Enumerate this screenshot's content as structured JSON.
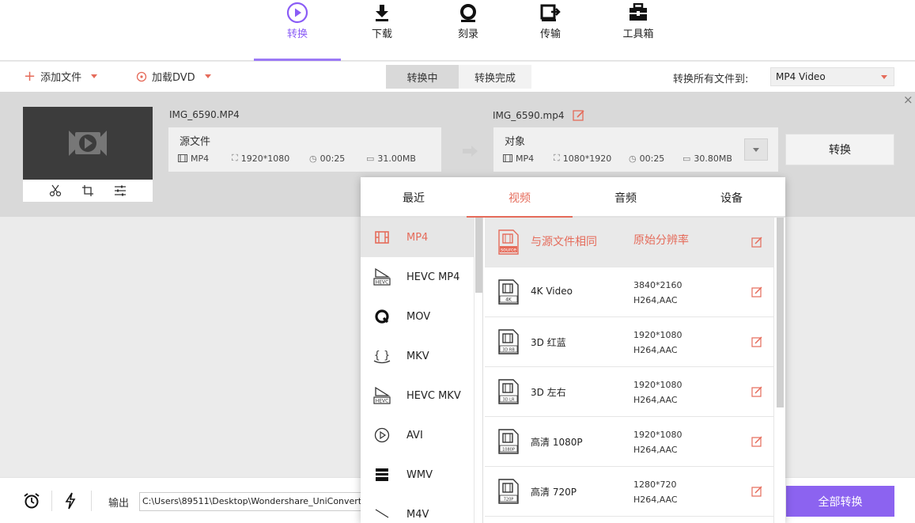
{
  "nav": {
    "items": [
      {
        "label": "转换",
        "icon": "convert-play-icon",
        "active": true
      },
      {
        "label": "下载",
        "icon": "download-icon",
        "active": false
      },
      {
        "label": "刻录",
        "icon": "burn-disc-icon",
        "active": false
      },
      {
        "label": "传输",
        "icon": "transfer-icon",
        "active": false
      },
      {
        "label": "工具箱",
        "icon": "toolbox-icon",
        "active": false
      }
    ]
  },
  "toolbar": {
    "add_files": "添加文件",
    "load_dvd": "加载DVD",
    "tab_converting": "转换中",
    "tab_converted": "转换完成",
    "convert_all_to_label": "转换所有文件到:",
    "convert_all_to_value": "MP4 Video"
  },
  "file": {
    "source_name": "IMG_6590.MP4",
    "target_name": "IMG_6590.mp4",
    "source": {
      "title": "源文件",
      "format": "MP4",
      "resolution": "1920*1080",
      "duration": "00:25",
      "size": "31.00MB"
    },
    "target": {
      "title": "对象",
      "format": "MP4",
      "resolution": "1080*1920",
      "duration": "00:25",
      "size": "30.80MB"
    },
    "convert_button": "转换"
  },
  "bottom": {
    "output_label": "输出",
    "output_path": "C:\\Users\\89511\\Desktop\\Wondershare_UniConvert",
    "convert_all_button": "全部转换"
  },
  "popup": {
    "tabs": [
      "最近",
      "视频",
      "音频",
      "设备"
    ],
    "active_tab": "视频",
    "formats": [
      {
        "label": "MP4",
        "icon": "film-icon",
        "active": true
      },
      {
        "label": "HEVC MP4",
        "icon": "hevc-icon",
        "active": false
      },
      {
        "label": "MOV",
        "icon": "quicktime-icon",
        "active": false
      },
      {
        "label": "MKV",
        "icon": "mkv-icon",
        "active": false
      },
      {
        "label": "HEVC MKV",
        "icon": "hevc-icon",
        "active": false
      },
      {
        "label": "AVI",
        "icon": "play-circle-icon",
        "active": false
      },
      {
        "label": "WMV",
        "icon": "clapper-icon",
        "active": false
      },
      {
        "label": "M4V",
        "icon": "m4v-icon",
        "active": false
      }
    ],
    "presets": [
      {
        "name": "与源文件相同",
        "res1": "原始分辨率",
        "res2": "",
        "badge": "source",
        "active": true
      },
      {
        "name": "4K Video",
        "res1": "3840*2160",
        "res2": "H264,AAC",
        "badge": "4K",
        "active": false
      },
      {
        "name": "3D 红蓝",
        "res1": "1920*1080",
        "res2": "H264,AAC",
        "badge": "3D RB",
        "active": false
      },
      {
        "name": "3D 左右",
        "res1": "1920*1080",
        "res2": "H264,AAC",
        "badge": "3D LR",
        "active": false
      },
      {
        "name": "高清 1080P",
        "res1": "1920*1080",
        "res2": "H264,AAC",
        "badge": "1080P",
        "active": false
      },
      {
        "name": "高清 720P",
        "res1": "1280*720",
        "res2": "H264,AAC",
        "badge": "720P",
        "active": false
      }
    ]
  },
  "colors": {
    "accent": "#8c63f0",
    "highlight": "#e56b5a"
  }
}
